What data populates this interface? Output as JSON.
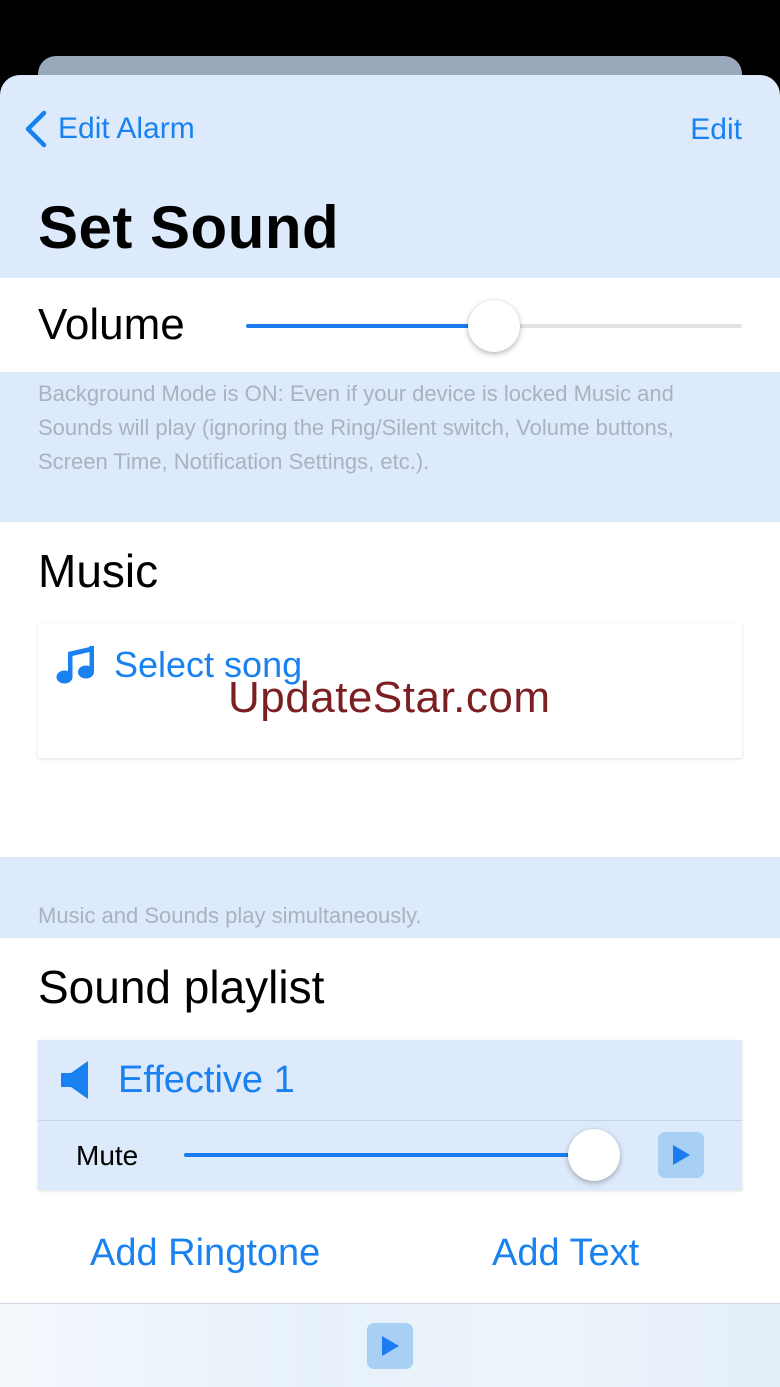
{
  "nav": {
    "back_label": "Edit Alarm",
    "edit_label": "Edit",
    "title": "Set Sound"
  },
  "volume": {
    "label": "Volume",
    "level": 0.5
  },
  "notes": {
    "background_mode": "Background Mode is ON: Even if your device is locked Music and Sounds will play (ignoring the Ring/Silent switch, Volume buttons, Screen Time, Notification Settings, etc.).",
    "simultaneous": "Music and Sounds play simultaneously."
  },
  "music": {
    "title": "Music",
    "select_song_label": "Select song",
    "icon": "music-note-icon"
  },
  "watermark": "UpdateStar.com",
  "playlist": {
    "title": "Sound playlist",
    "items": [
      {
        "name": "Effective 1",
        "icon": "speaker-icon",
        "mute_label": "Mute",
        "volume_level": 1.0
      }
    ],
    "add_ringtone_label": "Add Ringtone",
    "add_text_label": "Add Text"
  },
  "colors": {
    "accent": "#1a82f0",
    "sheet_background": "#ddeafb",
    "play_button": "#a8cff4",
    "watermark": "#7b1f22"
  }
}
